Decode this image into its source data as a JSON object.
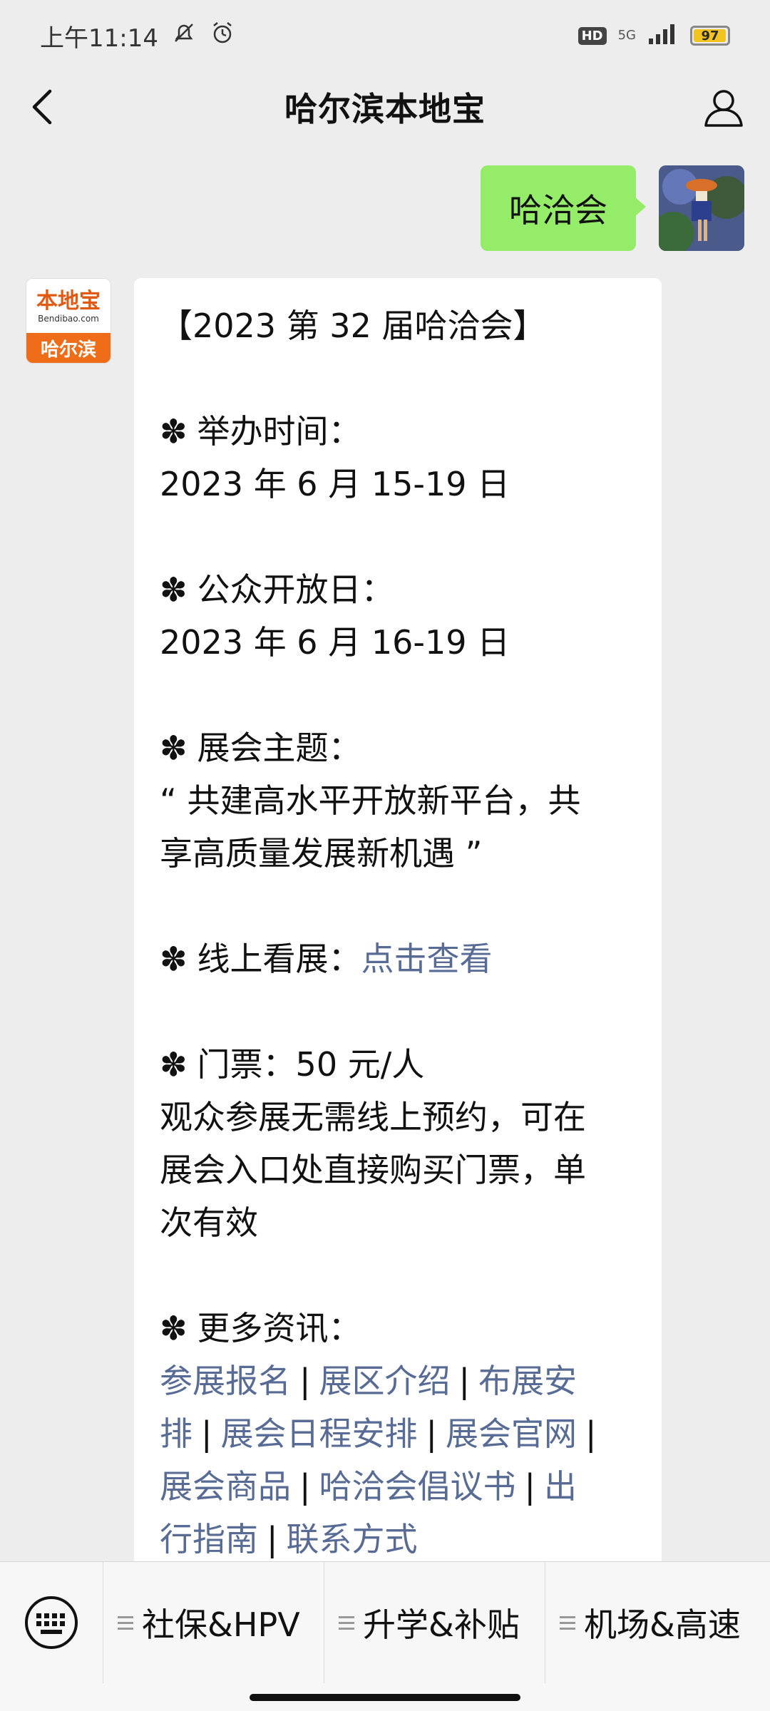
{
  "status_bar": {
    "time": "上午11:14",
    "hd": "HD",
    "network": "5G",
    "battery": "97",
    "battery_color": "#f3c321"
  },
  "header": {
    "title": "哈尔滨本地宝",
    "back_icon": "chevron-left-icon",
    "profile_icon": "person-icon"
  },
  "sent_message": {
    "text": "哈洽会"
  },
  "bot_avatar": {
    "logo_text": "本地宝",
    "logo_sub": "Bendibao.com",
    "city": "哈尔滨"
  },
  "received_message": {
    "heading": "【2023 第 32 届哈洽会】",
    "sections": {
      "time": {
        "label": "举办时间：",
        "value": "2023 年 6 月 15-19 日"
      },
      "public_days": {
        "label": "公众开放日：",
        "value": "2023 年 6 月 16-19 日"
      },
      "theme": {
        "label": "展会主题：",
        "line1": "“ 共建高水平开放新平台，共",
        "line2": "享高质量发展新机遇 ”"
      },
      "online": {
        "label": "线上看展：",
        "link": "点击查看"
      },
      "ticket": {
        "label": "门票：50 元/人",
        "line1": "观众参展无需线上预约，可在",
        "line2": "展会入口处直接购买门票，单",
        "line3": "次有效"
      },
      "more": {
        "label": "更多资讯：",
        "links": [
          "参展报名",
          "展区介绍",
          "布展安",
          "排",
          "展会日程安排",
          "展会官网",
          "展会商品",
          "哈洽会倡议书",
          "出",
          "行指南",
          "联系方式"
        ],
        "separator": "|"
      }
    }
  },
  "bottom_menu": {
    "keyboard_icon": "keyboard-icon",
    "items": [
      "社保&HPV",
      "升学&补贴",
      "机场&高速"
    ]
  }
}
